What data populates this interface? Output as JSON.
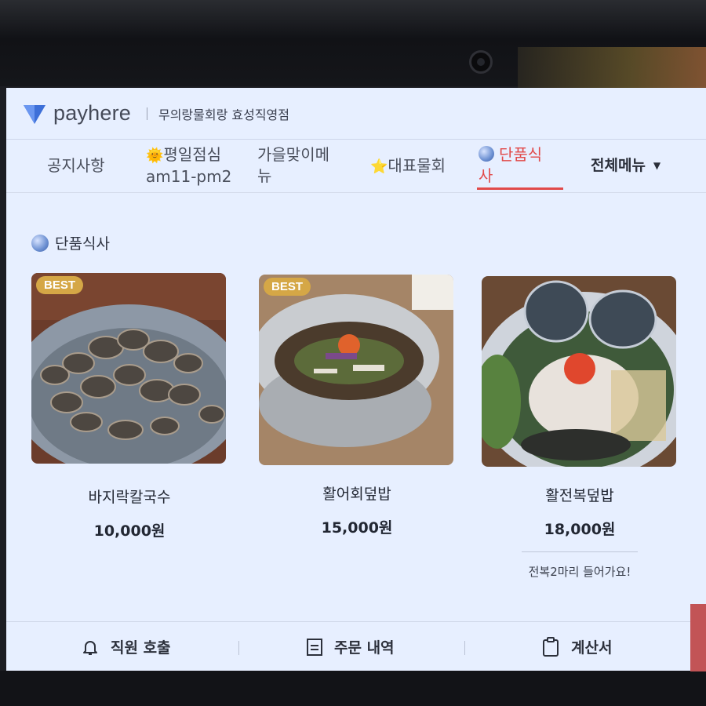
{
  "app": {
    "logo_text": "payhere",
    "store_name": "무의랑물회랑 효성직영점"
  },
  "tabs": [
    {
      "label_line1": "공지사항",
      "label_line2": "",
      "icon": ""
    },
    {
      "label_line1": "평일점심",
      "label_line2": "am11-pm2",
      "icon": "sun-emoji"
    },
    {
      "label_line1": "가을맞이메",
      "label_line2": "뉴",
      "icon": ""
    },
    {
      "label_line1": "대표물회",
      "label_line2": "",
      "icon": "star-emoji"
    },
    {
      "label_line1": "단품식",
      "label_line2": "사",
      "icon": "blue-circle-emoji",
      "active": true
    }
  ],
  "all_menu_label": "전체메뉴",
  "section": {
    "title": "단품식사",
    "icon": "blue-circle-emoji"
  },
  "menu_items": [
    {
      "name": "바지락칼국수",
      "price": "10,000원",
      "badge": "BEST",
      "description": ""
    },
    {
      "name": "활어회덮밥",
      "price": "15,000원",
      "badge": "BEST",
      "description": ""
    },
    {
      "name": "활전복덮밥",
      "price": "18,000원",
      "badge": "",
      "description": "전복2마리 들어가요!"
    }
  ],
  "bottom_bar": {
    "call_staff": "직원 호출",
    "order_history": "주문 내역",
    "bill": "계산서"
  },
  "colors": {
    "screen_bg": "#e7efff",
    "accent": "#e14a4a",
    "badge": "#d5a746",
    "logo": "#3d6fd8"
  }
}
